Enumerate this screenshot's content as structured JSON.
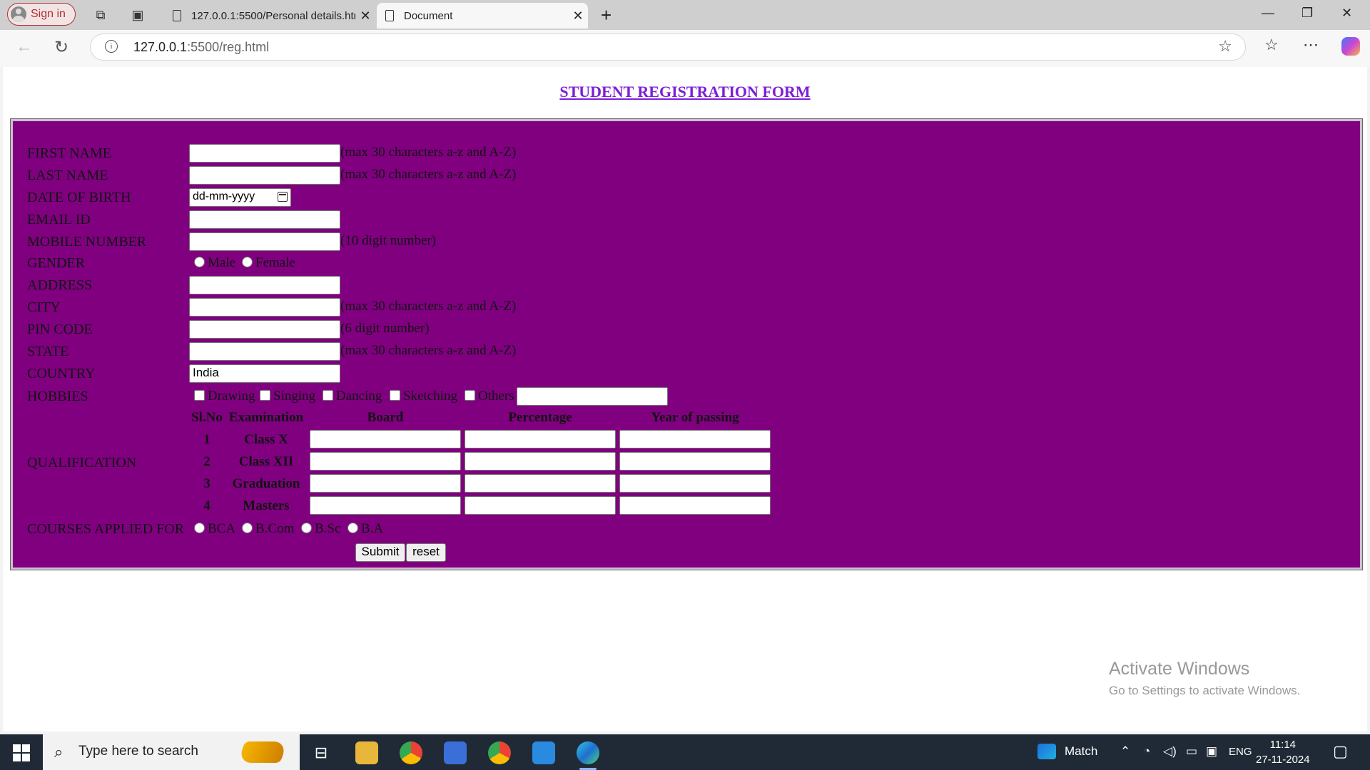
{
  "browser": {
    "sign_in_label": "Sign in",
    "tabs": [
      {
        "title": "127.0.0.1:5500/Personal details.html",
        "active": false
      },
      {
        "title": "Document",
        "active": true
      }
    ],
    "url_host": "127.0.0.1",
    "url_rest": ":5500/reg.html"
  },
  "form": {
    "title": "STUDENT REGISTRATION FORM",
    "labels": {
      "first_name": "FIRST NAME",
      "last_name": "LAST NAME",
      "dob": "DATE OF BIRTH",
      "email": "EMAIL ID",
      "mobile": "MOBILE NUMBER",
      "gender": "GENDER",
      "address": "ADDRESS",
      "city": "CITY",
      "pin": "PIN CODE",
      "state": "STATE",
      "country": "COUNTRY",
      "hobbies": "HOBBIES",
      "qualification": "QUALIFICATION",
      "courses": "COURSES APPLIED FOR"
    },
    "hints": {
      "chars30": "(max 30 characters a-z and A-Z)",
      "digits10": "(10 digit number)",
      "digits6": "(6 digit number)"
    },
    "dob_placeholder": "dd-mm-yyyy",
    "country_value": "India",
    "gender_options": [
      "Male",
      "Female"
    ],
    "hobbies": [
      "Drawing",
      "Singing",
      "Dancing",
      "Sketching",
      "Others"
    ],
    "qualification_headers": [
      "Sl.No",
      "Examination",
      "Board",
      "Percentage",
      "Year of passing"
    ],
    "qualification_rows": [
      {
        "no": "1",
        "exam": "Class X"
      },
      {
        "no": "2",
        "exam": "Class XII"
      },
      {
        "no": "3",
        "exam": "Graduation"
      },
      {
        "no": "4",
        "exam": "Masters"
      }
    ],
    "courses": [
      "BCA",
      "B.Com",
      "B.Sc",
      "B.A"
    ],
    "submit_label": "Submit",
    "reset_label": "reset"
  },
  "watermark": {
    "line1": "Activate Windows",
    "line2": "Go to Settings to activate Windows."
  },
  "taskbar": {
    "search_placeholder": "Type here to search",
    "weather_text": "Match",
    "language": "ENG",
    "time": "11:14",
    "date": "27-11-2024"
  }
}
